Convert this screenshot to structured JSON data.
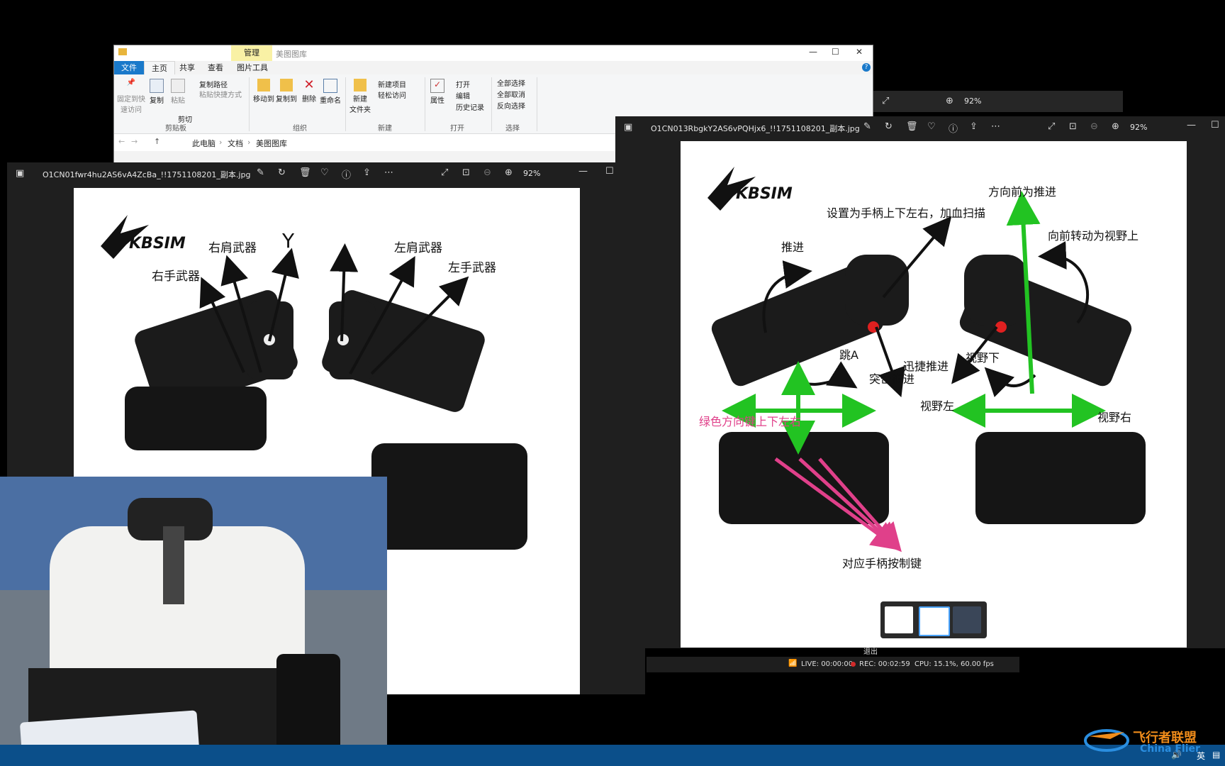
{
  "explorer": {
    "context_tab": "管理",
    "context_sub": "美图图库",
    "tabs": [
      "文件",
      "主页",
      "共享",
      "查看",
      "图片工具"
    ],
    "ribbon": {
      "pin": "固定到快\n速访问",
      "copy": "复制",
      "paste": "粘贴",
      "copy_path": "复制路径",
      "paste_shortcut": "粘贴快捷方式",
      "cut": "剪切",
      "move_to": "移动到",
      "copy_to": "复制到",
      "delete": "删除",
      "rename": "重命名",
      "new_folder": "新建\n文件夹",
      "new_item": "新建项目",
      "easy_access": "轻松访问",
      "properties": "属性",
      "open": "打开",
      "edit": "编辑",
      "history": "历史记录",
      "select_all": "全部选择",
      "select_none": "全部取消",
      "invert": "反向选择",
      "groups": [
        "剪贴板",
        "组织",
        "新建",
        "打开",
        "选择"
      ]
    },
    "breadcrumb": [
      "此电脑",
      "文档",
      "美图图库"
    ]
  },
  "viewer_left": {
    "filename": "O1CN01fwr4hu2AS6vA4ZcBa_!!1751108201_副本.jpg",
    "zoom": "92%",
    "labels": {
      "right_hand": "右手武器",
      "right_shoulder": "右肩武器",
      "y": "Y",
      "left_shoulder": "左肩武器",
      "left_hand": "左手武器"
    }
  },
  "viewer_right": {
    "filename": "O1CN013RbgkY2AS6vPQHjx6_!!1751108201_副本.jpg",
    "zoom": "92%",
    "labels": {
      "set_hat": "设置为手柄上下左右，加血扫描",
      "forward_thrust": "方向前为推进",
      "forward_rotate": "向前转动为视野上",
      "thrust": "推进",
      "jump": "跳A",
      "dash": "突击推进",
      "quick_thrust": "迅捷推进",
      "view_down": "视野下",
      "view_left": "视野左",
      "view_right": "视野右",
      "green_dpad": "绿色方向键上下左右",
      "bottom_keys": "对应手柄按制键"
    }
  },
  "back_viewer": {
    "zoom": "92%"
  },
  "obs": {
    "live": "LIVE: 00:00:00",
    "rec": "REC: 00:02:59",
    "cpu": "CPU: 15.1%, 60.00 fps",
    "stop": "退出"
  },
  "taskbar": {
    "ime": "英",
    "watermark": "飞行者联盟",
    "watermark_sub": "China Flier"
  },
  "brand": "KBSIM",
  "colors": {
    "green_arrow": "#22c322",
    "pink_arrow": "#e0408a",
    "file_tab": "#1979ca"
  }
}
